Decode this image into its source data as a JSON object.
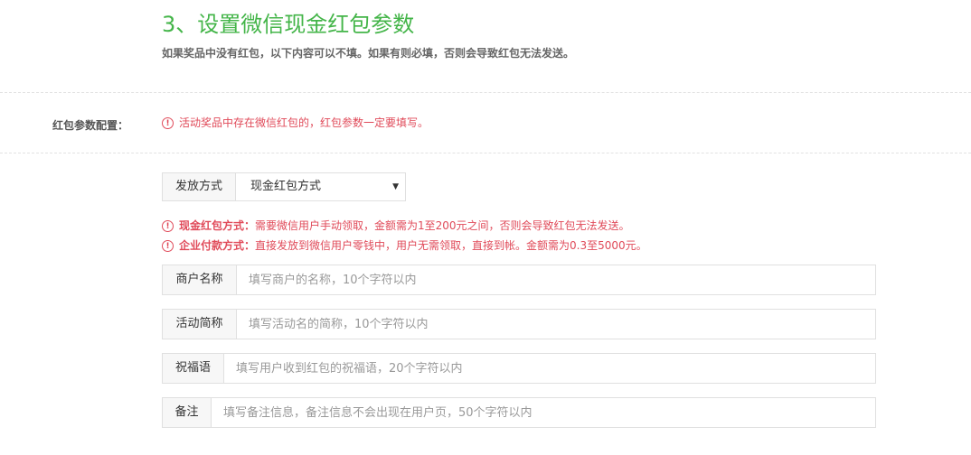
{
  "section": {
    "title": "3、设置微信现金红包参数",
    "subtitle": "如果奖品中没有红包，以下内容可以不填。如果有则必填，否则会导致红包无法发送。"
  },
  "config_row": {
    "label": "红包参数配置：",
    "notice": "活动奖品中存在微信红包的，红包参数一定要填写。"
  },
  "icons": {
    "warning": "warning-circle-icon",
    "dropdown": "chevron-down-icon"
  },
  "colors": {
    "accent": "#44b549",
    "warning": "#e04a59",
    "border": "#e0e0e0",
    "addon_bg": "#f7f7f7"
  },
  "payment": {
    "label": "发放方式",
    "selected": "现金红包方式",
    "cash_note_title": "现金红包方式：",
    "cash_note_text": "需要微信用户手动领取，金额需为1至200元之间，否则会导致红包无法发送。",
    "corp_note_title": "企业付款方式：",
    "corp_note_text": "直接发放到微信用户零钱中，用户无需领取，直接到帐。金额需为0.3至5000元。"
  },
  "fields": {
    "merchant": {
      "label": "商户名称",
      "placeholder": "填写商户的名称，10个字符以内",
      "value": ""
    },
    "activity": {
      "label": "活动简称",
      "placeholder": "填写活动名的简称，10个字符以内",
      "value": ""
    },
    "wishing": {
      "label": "祝福语",
      "placeholder": "填写用户收到红包的祝福语，20个字符以内",
      "value": ""
    },
    "remark": {
      "label": "备注",
      "placeholder": "填写备注信息，备注信息不会出现在用户页，50个字符以内",
      "value": ""
    }
  }
}
